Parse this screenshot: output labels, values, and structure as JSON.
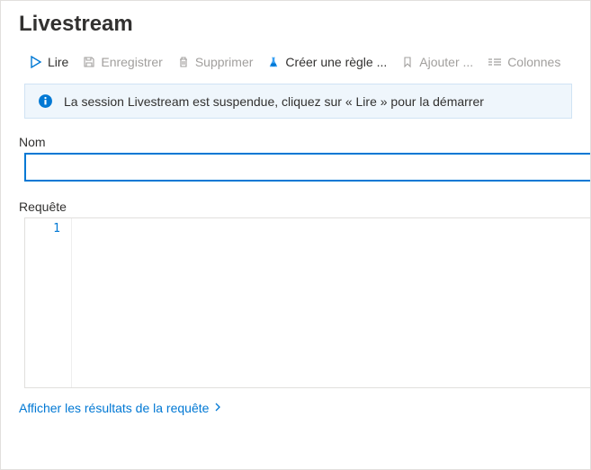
{
  "header": {
    "title": "Livestream"
  },
  "toolbar": {
    "play": "Lire",
    "save": "Enregistrer",
    "delete": "Supprimer",
    "create_rule": "Créer une règle ...",
    "add": "Ajouter ...",
    "columns": "Colonnes"
  },
  "banner": {
    "message": "La session Livestream est suspendue, cliquez sur « Lire » pour la démarrer"
  },
  "fields": {
    "name_label": "Nom",
    "name_value": "",
    "query_label": "Requête",
    "gutter_1": "1",
    "query_value": ""
  },
  "links": {
    "show_results": "Afficher les résultats de la requête"
  }
}
